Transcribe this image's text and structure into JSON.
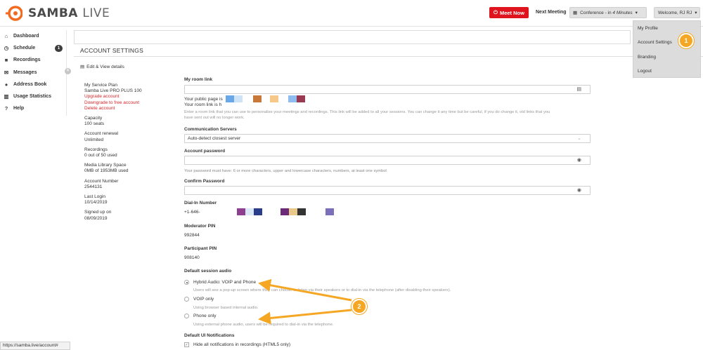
{
  "header": {
    "logo_brand": "SAMBA",
    "logo_suffix": "LIVE",
    "meet_now_label": "Meet Now",
    "next_meeting_label": "Next Meeting",
    "conference_label": "Conference - in",
    "conference_time": "4 Minutes",
    "welcome_label": "Welcome, RJ RJ"
  },
  "profile_menu": {
    "items": [
      {
        "label": "My Profile"
      },
      {
        "label": "Account Settings"
      },
      {
        "label": "Branding"
      },
      {
        "label": "Logout"
      }
    ]
  },
  "sidebar": {
    "items": [
      {
        "label": "Dashboard",
        "icon": "home-icon"
      },
      {
        "label": "Schedule",
        "icon": "clock-icon",
        "badge": "1"
      },
      {
        "label": "Recordings",
        "icon": "video-camera-icon"
      },
      {
        "label": "Messages",
        "icon": "envelope-icon"
      },
      {
        "label": "Address Book",
        "icon": "user-icon"
      },
      {
        "label": "Usage Statistics",
        "icon": "bar-chart-icon"
      },
      {
        "label": "Help",
        "icon": "question-icon"
      }
    ]
  },
  "page": {
    "title": "ACCOUNT SETTINGS",
    "edit_view_label": "Edit & View details"
  },
  "account_info": {
    "service_plan_label": "My Service Plan",
    "service_plan_value": "Samba Live PRO PLUS 100",
    "upgrade_link": "Upgrade account",
    "downgrade_link": "Downgrade to free account",
    "delete_link": "Delete account",
    "capacity_label": "Capacity",
    "capacity_value": "100 seats",
    "renewal_label": "Account renewal",
    "renewal_value": "Unlimited",
    "recordings_label": "Recordings",
    "recordings_value": "0 out of 50 used",
    "media_label": "Media Library Space",
    "media_value": "0MB of 1953MB used",
    "account_number_label": "Account Number",
    "account_number_value": "2544131",
    "last_login_label": "Last Login",
    "last_login_value": "10/14/2019",
    "signed_up_label": "Signed up on",
    "signed_up_value": "08/09/2019"
  },
  "form": {
    "room_link_label": "My room link",
    "public_page_text": "Your public page is",
    "room_link_text": "Your room link is h",
    "room_link_help_1": "Enter a room link that you can use to personalise your meetings and recordings. This link will be added to all your sessions. You can change it any time but be careful, if you do change it, old links that you",
    "room_link_help_2": "have sent out will no longer work.",
    "comm_servers_label": "Communication Servers",
    "comm_servers_value": "Auto-detect closest server",
    "account_password_label": "Account password",
    "password_help": "Your password must have: 6 or more characters, upper and lowercase characters, numbers, at least one symbol",
    "confirm_password_label": "Confirm Password",
    "dialin_label": "Dial-In Number",
    "dialin_value": "+1-646-",
    "moderator_pin_label": "Moderator PIN",
    "moderator_pin_value": "992844",
    "participant_pin_label": "Participant PIN",
    "participant_pin_value": "908140",
    "session_audio_label": "Default session audio",
    "audio_options": [
      {
        "label": "Hybrid Audio: VOIP and Phone",
        "help": "Users will see a pop-up screen where they can choose to listen via their speakers or to dial-in via the telephone (after disabling their speakers).",
        "selected": true
      },
      {
        "label": "VOIP only",
        "help": "Using browser based internal audio.",
        "selected": false
      },
      {
        "label": "Phone only",
        "help": "Using external phone audio, users will be required to dial-in via the telephone.",
        "selected": false
      }
    ],
    "ui_notifications_label": "Default UI Notifications",
    "hide_notifications_label": "Hide all notifications in recordings (HTML5 only)"
  },
  "redaction_colors": [
    "#6aa7e8",
    "#cfe3f7",
    "#c8793a",
    "#f6c98a",
    "#8fbdf0",
    "#9a3a52",
    "#8e3f8f",
    "#dbe8f8",
    "#2a3c8a",
    "#6b2a78",
    "#e8c98a",
    "#333333",
    "#7a6fb8"
  ],
  "annotations": {
    "callout_1": "1",
    "callout_2": "2",
    "accent_color": "#f5a623"
  },
  "status_bar": {
    "url": "https://samba.live/account#"
  }
}
